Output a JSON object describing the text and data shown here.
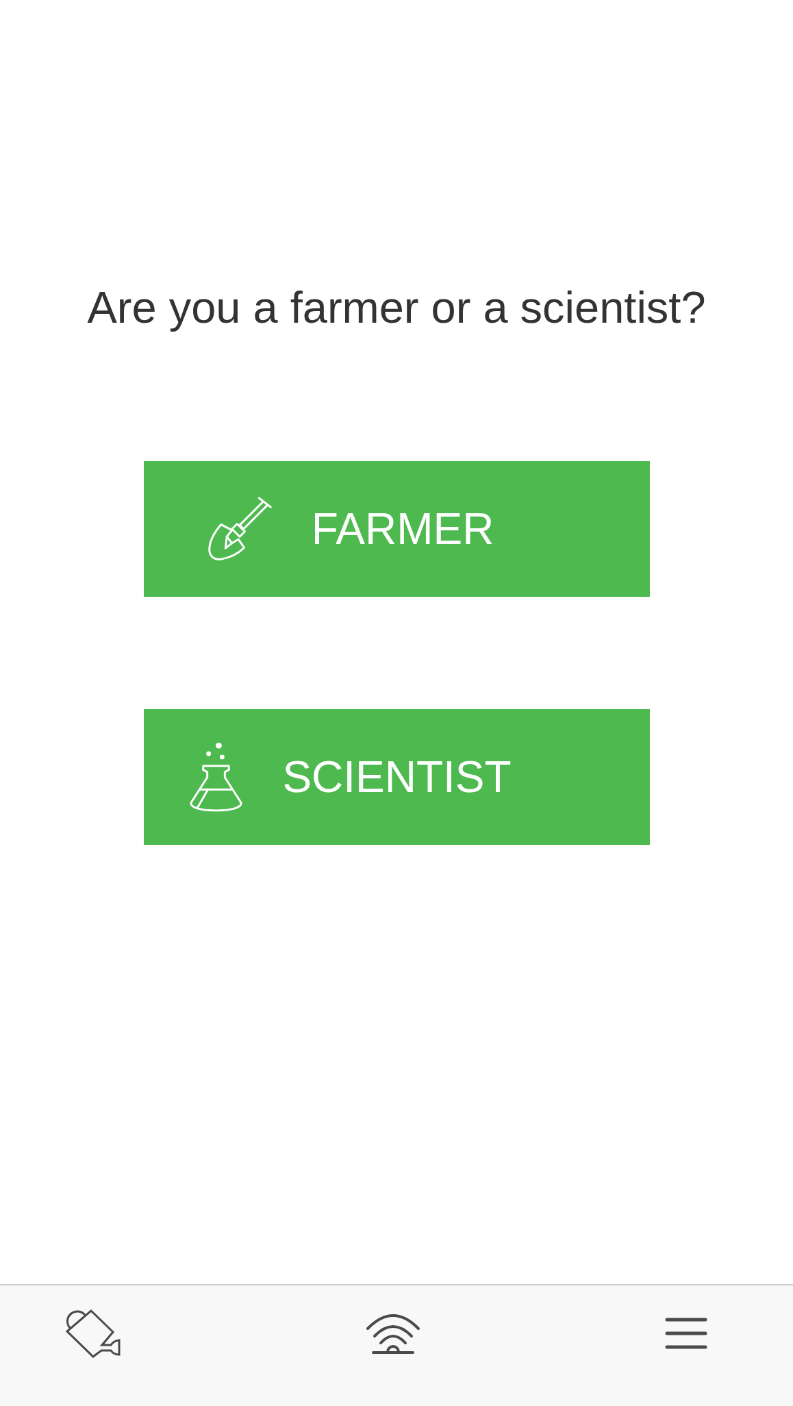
{
  "question": "Are you a farmer or a scientist?",
  "options": [
    {
      "label": "FARMER"
    },
    {
      "label": "SCIENTIST"
    }
  ]
}
